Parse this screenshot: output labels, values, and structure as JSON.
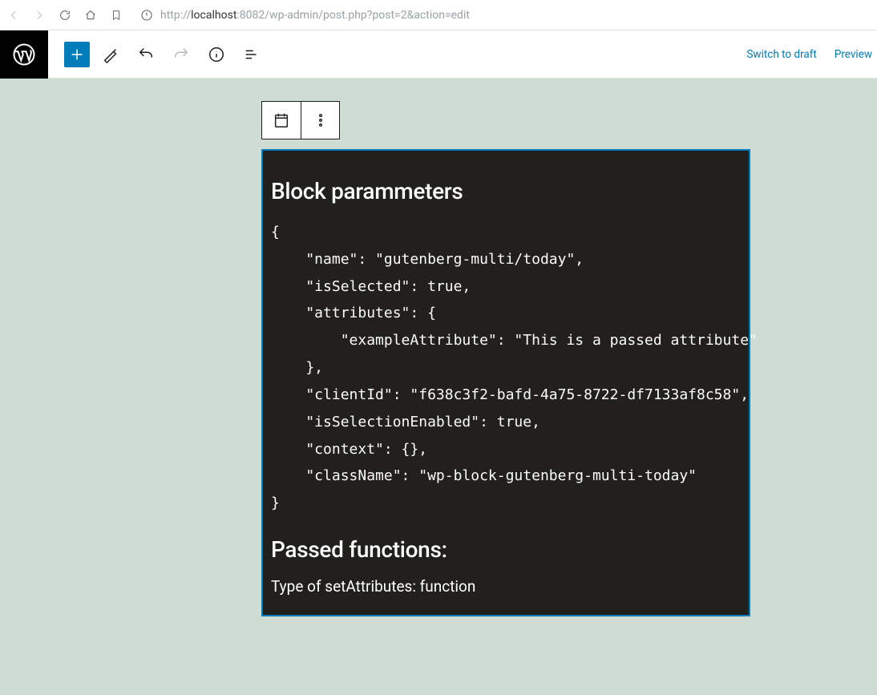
{
  "browser": {
    "url_proto": "http://",
    "url_host_strong": "localhost",
    "url_port_path": ":8082/wp-admin/post.php?post=2&action=edit"
  },
  "editor": {
    "switch_to_draft": "Switch to draft",
    "preview": "Preview"
  },
  "block": {
    "heading1": "Block parammeters",
    "code": "{\n    \"name\": \"gutenberg-multi/today\",\n    \"isSelected\": true,\n    \"attributes\": {\n        \"exampleAttribute\": \"This is a passed attribute\"\n    },\n    \"clientId\": \"f638c3f2-bafd-4a75-8722-df7133af8c58\",\n    \"isSelectionEnabled\": true,\n    \"context\": {},\n    \"className\": \"wp-block-gutenberg-multi-today\"\n}",
    "heading2": "Passed functions:",
    "paragraph": "Type of setAttributes: function"
  }
}
